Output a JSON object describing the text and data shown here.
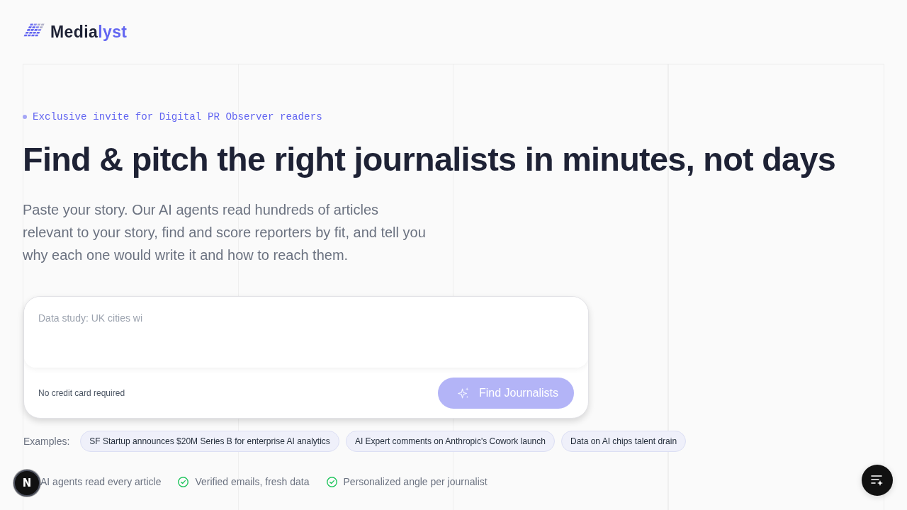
{
  "header": {
    "logo": {
      "parts": [
        {
          "text": "Media",
          "kind": "base"
        },
        {
          "text": "lyst",
          "kind": "accent"
        }
      ]
    }
  },
  "hero": {
    "eyebrow": "Exclusive invite for Digital PR Observer readers",
    "title": "Find & pitch the right journalists in minutes, not days",
    "description": "Paste your story. Our AI agents read hundreds of articles relevant to your story, find and score reporters by fit, and tell you why each one would write it and how to reach them."
  },
  "story_box": {
    "placeholder": "Data study: UK cities wi",
    "note": "No credit card required",
    "submit": {
      "label": "Find Journalists",
      "disabled": true
    }
  },
  "examples": {
    "label": "Examples:",
    "chips": [
      "SF Startup announces $20M Series B for enterprise AI analytics",
      "AI Expert comments on Anthropic's Cowork launch",
      "Data on AI chips talent drain"
    ]
  },
  "features": [
    {
      "text": "AI agents read every article",
      "kind": "plain"
    },
    {
      "text": "Verified emails, fresh data",
      "kind": "check"
    },
    {
      "text": "Personalized angle per journalist",
      "kind": "check"
    }
  ],
  "overlays": {
    "dev_badge": {
      "label": "N"
    }
  }
}
